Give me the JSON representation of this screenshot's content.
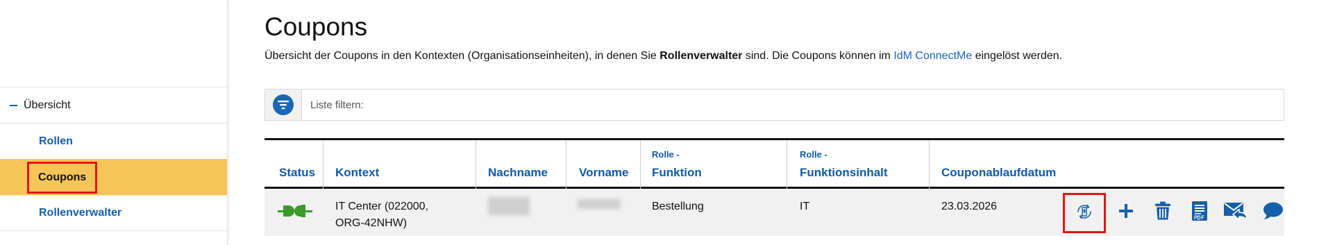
{
  "sidebar": {
    "items": [
      {
        "label": "Übersicht",
        "type": "parent"
      },
      {
        "label": "Rollen",
        "type": "child"
      },
      {
        "label": "Coupons",
        "type": "child",
        "active": true
      },
      {
        "label": "Rollenverwalter",
        "type": "child"
      }
    ]
  },
  "main": {
    "title": "Coupons",
    "description": {
      "before": "Übersicht der Coupons in den Kontexten (Organisationseinheiten), in denen Sie ",
      "bold": "Rollenverwalter",
      "middle": " sind. Die Coupons können im ",
      "link": "IdM ConnectMe",
      "after": " eingelöst werden."
    },
    "filter": {
      "placeholder": "Liste filtern:"
    },
    "table": {
      "columns": {
        "status": "Status",
        "kontext": "Kontext",
        "nachname": "Nachname",
        "vorname": "Vorname",
        "rolle_funktion_sub": "Rolle -",
        "rolle_funktion": "Funktion",
        "rolle_inhalt_sub": "Rolle -",
        "rolle_inhalt": "Funktionsinhalt",
        "ablauf": "Couponablaufdatum"
      },
      "rows": [
        {
          "status_icon": "plug-connected-icon",
          "kontext_line1": "IT Center (022000,",
          "kontext_line2": "ORG-42NHW)",
          "funktion": "Bestellung",
          "inhalt": "IT",
          "ablauf": "23.03.2026"
        }
      ],
      "actions": [
        "rotate-phone-icon",
        "plus-icon",
        "trash-icon",
        "pdf-icon",
        "mail-forward-icon",
        "comment-icon"
      ]
    }
  },
  "colors": {
    "accent": "#1560a8",
    "active": "#f7c557",
    "highlight": "#e21414",
    "status_green": "#3a9a2a"
  }
}
